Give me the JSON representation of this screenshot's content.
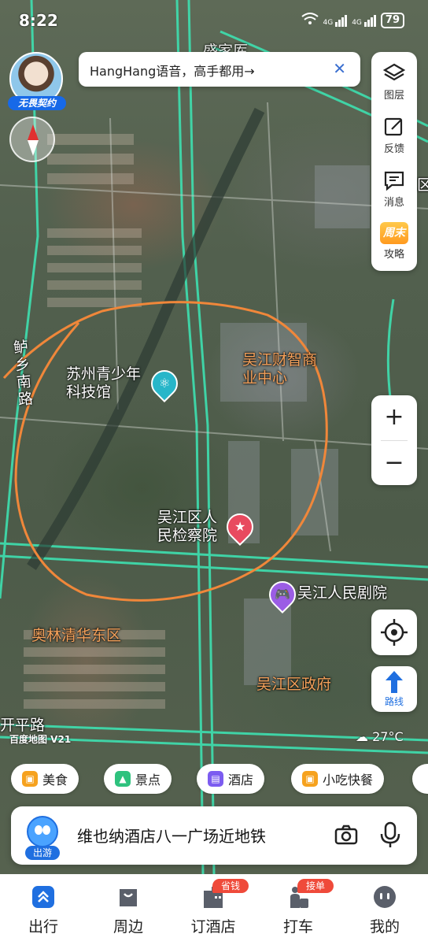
{
  "status_bar": {
    "time": "8:22",
    "wifi": "wifi",
    "signal1": "4G",
    "signal2": "4G",
    "battery": "79"
  },
  "avatar": {
    "badge": "无畏契约"
  },
  "voice_banner": {
    "text": "HangHang语音，高手都用→",
    "close": "✕"
  },
  "tools": [
    {
      "label": "图层",
      "icon": "layers-icon"
    },
    {
      "label": "反馈",
      "icon": "feedback-icon"
    },
    {
      "label": "消息",
      "icon": "message-icon"
    },
    {
      "label": "攻略",
      "icon": "weekend-guide-icon",
      "tag": "周末"
    }
  ],
  "zoom": {
    "in": "+",
    "out": "−"
  },
  "route_button": {
    "label": "路线"
  },
  "map": {
    "labels": {
      "road_top": "盛家厍",
      "road_left": "鲈乡南路",
      "museum": "苏州青少年科技馆",
      "finance_center": "吴江财智商业中心",
      "procuratorate": "吴江区人民检察院",
      "theater": "吴江人民剧院",
      "olympic": "奥林清华东区",
      "gov": "吴江区政府",
      "road_bottom": "开平路",
      "right_edge": "吴江区国"
    },
    "logo": "百度地图 V21",
    "highlight_color": "#f0873a",
    "road_color": "#3ee0b0"
  },
  "weather": {
    "temp": "27°C",
    "icon": "cloud-sun-icon"
  },
  "chips": [
    {
      "label": "美食",
      "color": "#f6a21e"
    },
    {
      "label": "景点",
      "color": "#2ec27e"
    },
    {
      "label": "酒店",
      "color": "#7c5cf0"
    },
    {
      "label": "小吃快餐",
      "color": "#f6a21e"
    }
  ],
  "search": {
    "mascot_tag": "出游",
    "query": "维也纳酒店八一广场近地铁"
  },
  "bottom_nav": [
    {
      "label": "出行",
      "active": true
    },
    {
      "label": "周边"
    },
    {
      "label": "订酒店",
      "badge": "省钱订"
    },
    {
      "label": "打车",
      "badge": "接单快"
    },
    {
      "label": "我的"
    }
  ]
}
